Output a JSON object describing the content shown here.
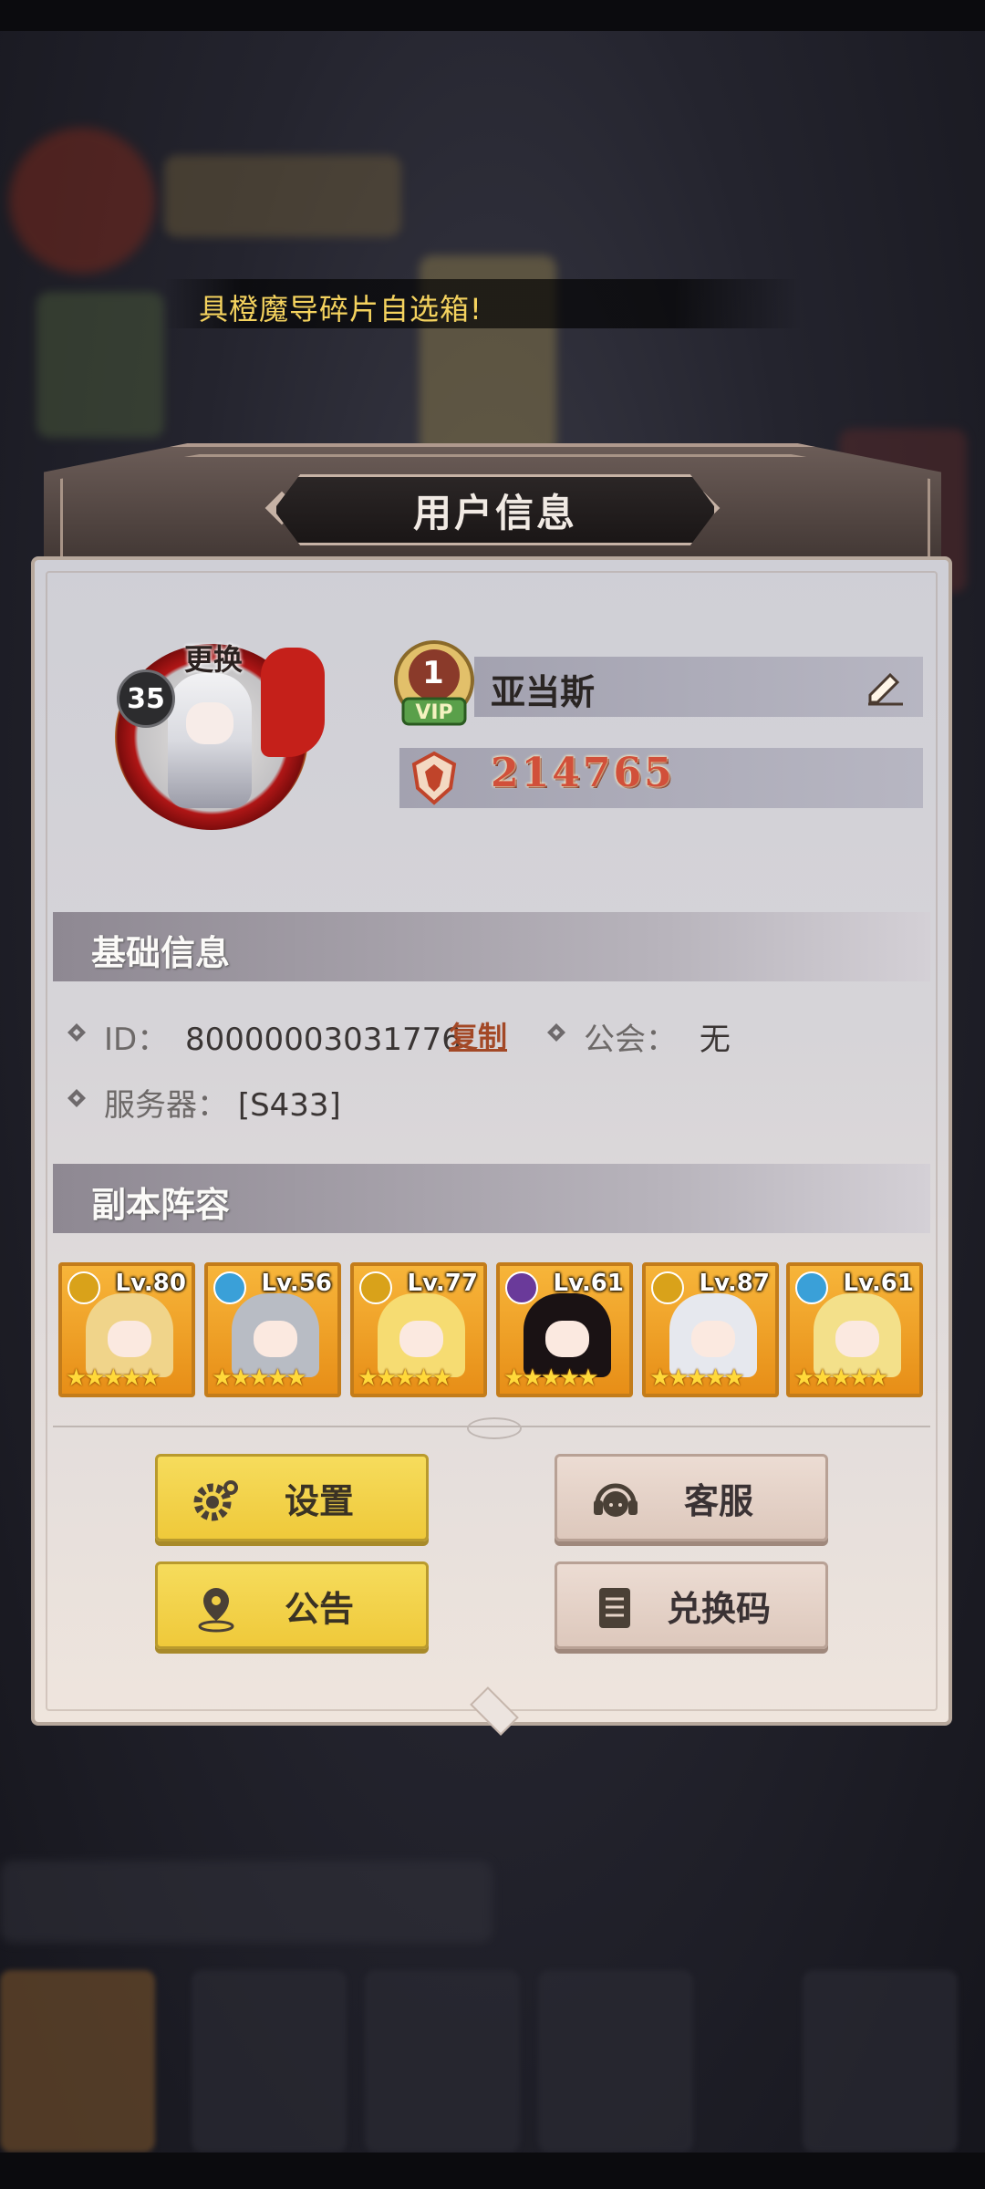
{
  "marquee": {
    "text": "具橙魔导碎片自选箱!"
  },
  "panel": {
    "title": "用户信息"
  },
  "profile": {
    "change_label": "更换",
    "level": "35",
    "vip_level": "1",
    "name": "亚当斯",
    "currency": "214765"
  },
  "basic_info": {
    "section_title": "基础信息",
    "id_label": "ID：",
    "id_value": "80000003031776",
    "copy_label": "复制",
    "guild_label": "公会：",
    "guild_value": "无",
    "server_label": "服务器：",
    "server_value": "[S433]"
  },
  "lineup": {
    "section_title": "副本阵容",
    "heroes": [
      {
        "level": "Lv.80",
        "stars": "★★★★★",
        "element_color": "#d9a21a",
        "hair_color": "#f0d48a"
      },
      {
        "level": "Lv.56",
        "stars": "★★★★★",
        "element_color": "#3aa0d8",
        "hair_color": "#b8bcc4"
      },
      {
        "level": "Lv.77",
        "stars": "★★★★★",
        "element_color": "#d9a21a",
        "hair_color": "#f6dc72"
      },
      {
        "level": "Lv.61",
        "stars": "★★★★★",
        "element_color": "#6a3a9a",
        "hair_color": "#1a1214"
      },
      {
        "level": "Lv.87",
        "stars": "★★★★★",
        "element_color": "#d9a21a",
        "hair_color": "#e6e8ee"
      },
      {
        "level": "Lv.61",
        "stars": "★★★★★",
        "element_color": "#3aa0d8",
        "hair_color": "#f3e08a"
      }
    ]
  },
  "buttons": {
    "settings": "设置",
    "customer_service": "客服",
    "announcement": "公告",
    "redeem_code": "兑换码"
  },
  "icons": {
    "edit": "pencil-icon",
    "currency": "crest-icon",
    "settings": "gear-icon",
    "customer_service": "headset-icon",
    "announcement": "location-pin-icon",
    "redeem_code": "document-icon"
  }
}
